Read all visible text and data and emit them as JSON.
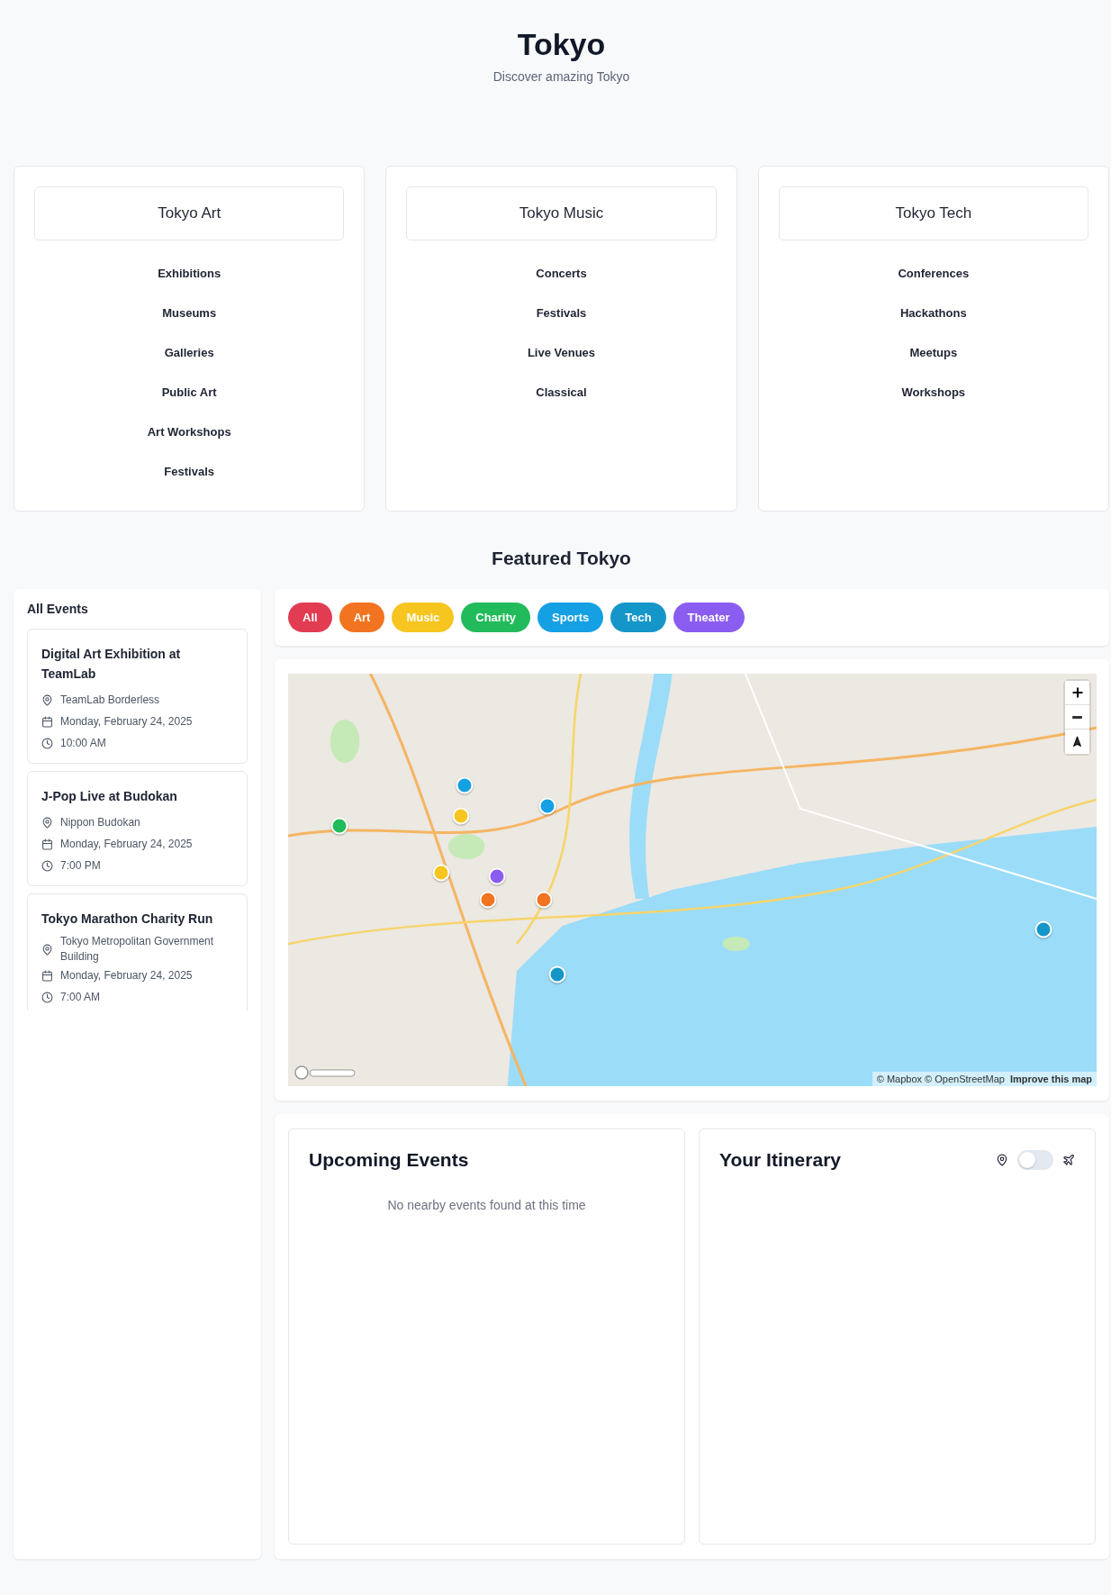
{
  "header": {
    "title": "Tokyo",
    "subtitle": "Discover amazing Tokyo"
  },
  "categories": [
    {
      "title": "Tokyo Art",
      "items": [
        "Exhibitions",
        "Museums",
        "Galleries",
        "Public Art",
        "Art Workshops",
        "Festivals"
      ]
    },
    {
      "title": "Tokyo Music",
      "items": [
        "Concerts",
        "Festivals",
        "Live Venues",
        "Classical"
      ]
    },
    {
      "title": "Tokyo Tech",
      "items": [
        "Conferences",
        "Hackathons",
        "Meetups",
        "Workshops"
      ]
    }
  ],
  "featured": {
    "title": "Featured Tokyo"
  },
  "events_list": {
    "title": "All Events",
    "events": [
      {
        "title": "Digital Art Exhibition at TeamLab",
        "venue": "TeamLab Borderless",
        "date": "Monday, February 24, 2025",
        "time": "10:00 AM"
      },
      {
        "title": "J-Pop Live at Budokan",
        "venue": "Nippon Budokan",
        "date": "Monday, February 24, 2025",
        "time": "7:00 PM"
      },
      {
        "title": "Tokyo Marathon Charity Run",
        "venue": "Tokyo Metropolitan Government Building",
        "date": "Monday, February 24, 2025",
        "time": "7:00 AM"
      }
    ]
  },
  "filters": [
    {
      "label": "All",
      "color": "#e23c52"
    },
    {
      "label": "Art",
      "color": "#f27420"
    },
    {
      "label": "Music",
      "color": "#f7c520"
    },
    {
      "label": "Charity",
      "color": "#22bb5b"
    },
    {
      "label": "Sports",
      "color": "#15a0e4"
    },
    {
      "label": "Tech",
      "color": "#1596c8"
    },
    {
      "label": "Theater",
      "color": "#8b5cf0"
    }
  ],
  "map": {
    "markers": [
      {
        "color": "#15a0e4"
      },
      {
        "color": "#15a0e4"
      },
      {
        "color": "#f7c520"
      },
      {
        "color": "#22bb5b"
      },
      {
        "color": "#f7c520"
      },
      {
        "color": "#8b5cf0"
      },
      {
        "color": "#f27420"
      },
      {
        "color": "#f27420"
      },
      {
        "color": "#1596c8"
      },
      {
        "color": "#1596c8"
      }
    ],
    "attribution": "© Mapbox © OpenStreetMap",
    "improve_link": "Improve this map"
  },
  "upcoming": {
    "title": "Upcoming Events",
    "empty_message": "No nearby events found at this time"
  },
  "itinerary": {
    "title": "Your Itinerary",
    "toggle_on": false
  }
}
